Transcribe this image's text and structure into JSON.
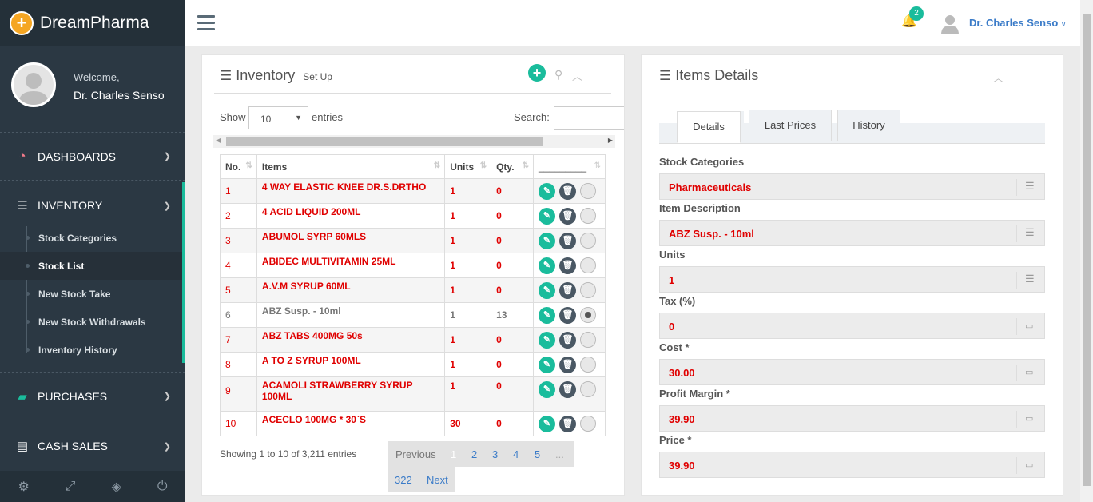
{
  "brand": {
    "name": "DreamPharma",
    "logo_symbol": "+"
  },
  "profile": {
    "welcome": "Welcome,",
    "name": "Dr. Charles Senso"
  },
  "nav": {
    "dashboards": "DASHBOARDS",
    "inventory": "INVENTORY",
    "purchases": "PURCHASES",
    "cash_sales": "CASH SALES",
    "sub": [
      "Stock Categories",
      "Stock List",
      "New Stock Take",
      "New Stock Withdrawals",
      "Inventory History"
    ]
  },
  "header": {
    "notifications": "2",
    "user": "Dr. Charles Senso"
  },
  "inventory": {
    "title": "Inventory",
    "subtitle": "Set Up",
    "show_label": "Show",
    "entries_label": "entries",
    "page_size": "10",
    "search_label": "Search:",
    "columns": [
      "No.",
      "Items",
      "Units",
      "Qty.",
      "_________"
    ],
    "rows": [
      {
        "no": "1",
        "item": "4 WAY ELASTIC KNEE DR.S.DRTHO",
        "units": "1",
        "qty": "0"
      },
      {
        "no": "2",
        "item": "4 ACID LIQUID 200ML",
        "units": "1",
        "qty": "0"
      },
      {
        "no": "3",
        "item": "ABUMOL SYRP 60MLS",
        "units": "1",
        "qty": "0"
      },
      {
        "no": "4",
        "item": "ABIDEC MULTIVITAMIN 25ML",
        "units": "1",
        "qty": "0"
      },
      {
        "no": "5",
        "item": "A.V.M SYRUP 60ML",
        "units": "1",
        "qty": "0"
      },
      {
        "no": "6",
        "item": "ABZ Susp. - 10ml",
        "units": "1",
        "qty": "13"
      },
      {
        "no": "7",
        "item": "ABZ TABS 400MG 50s",
        "units": "1",
        "qty": "0"
      },
      {
        "no": "8",
        "item": "A TO Z SYRUP 100ML",
        "units": "1",
        "qty": "0"
      },
      {
        "no": "9",
        "item": "ACAMOLI STRAWBERRY SYRUP 100ML",
        "units": "1",
        "qty": "0"
      },
      {
        "no": "10",
        "item": "ACECLO 100MG * 30`S",
        "units": "30",
        "qty": "0"
      }
    ],
    "info": "Showing 1 to 10 of 3,211 entries",
    "pagination": {
      "previous": "Previous",
      "pages": [
        "1",
        "2",
        "3",
        "4",
        "5",
        "..."
      ],
      "last": "322",
      "next": "Next"
    }
  },
  "details": {
    "title": "Items Details",
    "tabs": [
      "Details",
      "Last Prices",
      "History"
    ],
    "fields": [
      {
        "label": "Stock Categories",
        "value": "Pharmaceuticals"
      },
      {
        "label": "Item Description",
        "value": "ABZ Susp. - 10ml"
      },
      {
        "label": "Units",
        "value": "1"
      },
      {
        "label": "Tax (%)",
        "value": "0"
      },
      {
        "label": "Cost *",
        "value": "30.00"
      },
      {
        "label": "Profit Margin *",
        "value": "39.90"
      },
      {
        "label": "Price *",
        "value": "39.90"
      }
    ]
  },
  "colors": {
    "sidebar": "#2b3843",
    "accent": "#1abc9c",
    "alert": "#e00000",
    "link": "#3a7bc8"
  }
}
